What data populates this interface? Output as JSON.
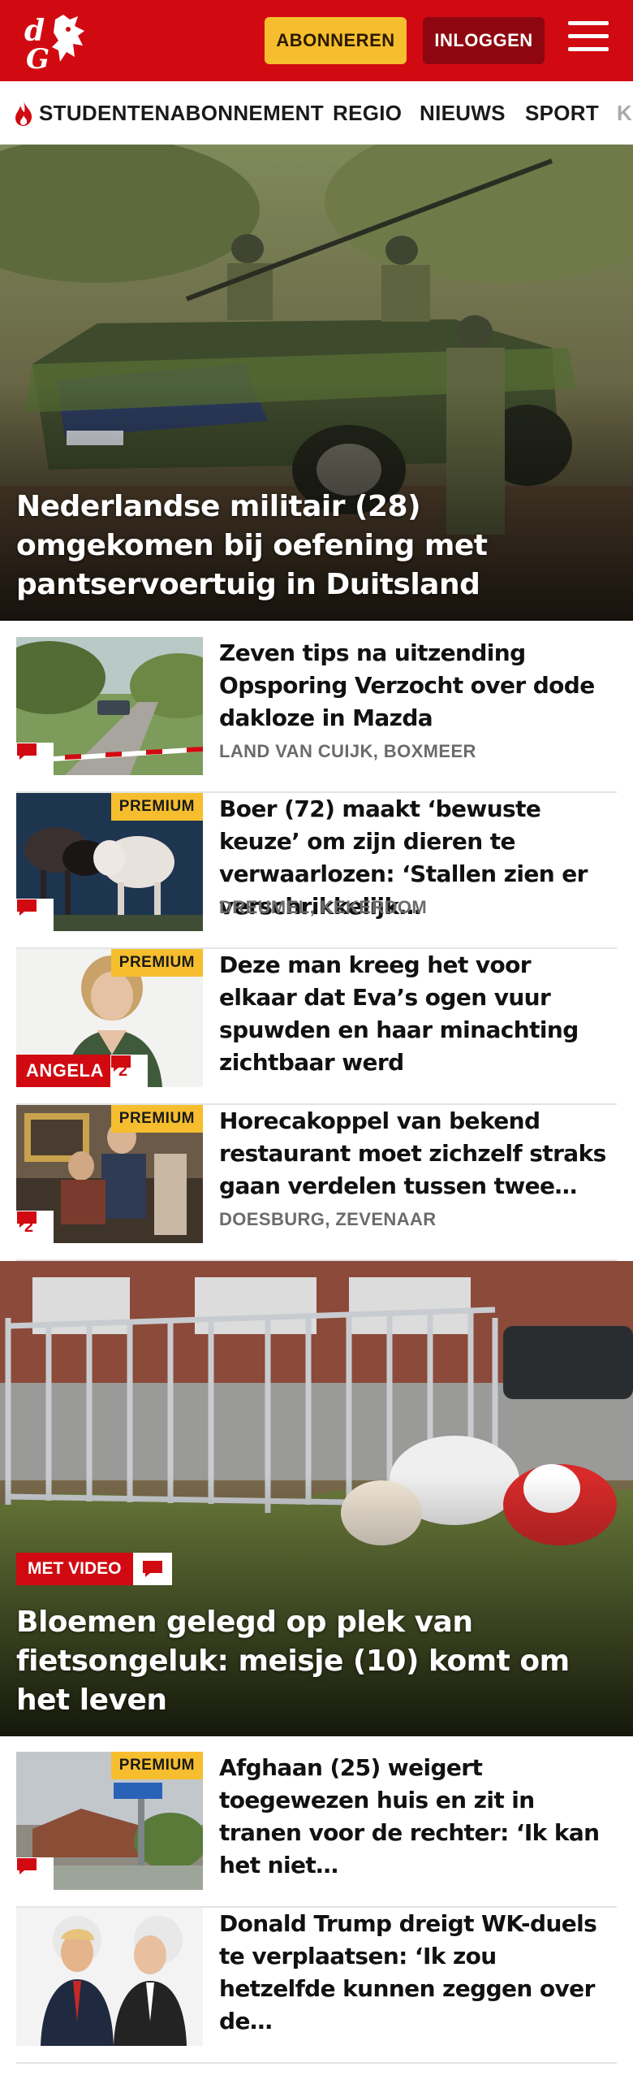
{
  "header": {
    "logo_text": "dG",
    "subscribe_label": "ABONNEREN",
    "login_label": "INLOGGEN",
    "brand_color": "#d10a11",
    "accent_color": "#f6be2e"
  },
  "nav": {
    "items": [
      {
        "label": "STUDENTENABONNEMENT",
        "icon": "flame-icon"
      },
      {
        "label": "REGIO"
      },
      {
        "label": "NIEUWS"
      },
      {
        "label": "SPORT"
      },
      {
        "label": "K"
      }
    ]
  },
  "hero1": {
    "title": "Nederlandse militair (28) omgekomen bij oefening met pantservoertuig in Duitsland"
  },
  "articles": [
    {
      "title": "Zeven tips na uitzending Opsporing Verzocht over dode dakloze in Mazda",
      "location": "LAND VAN CUIJK, BOXMEER",
      "comments": ""
    },
    {
      "title": "Boer (72) maakt ‘bewuste keuze’ om zijn dieren te verwaarlozen: ‘Stallen zien er verschrikkelijk…",
      "location": "DREUMEL, KEKERDOM",
      "premium": "PREMIUM",
      "comments": ""
    },
    {
      "title": "Deze man kreeg het voor elkaar dat Eva’s ogen vuur spuwden en haar minachting zichtbaar werd",
      "location": "",
      "premium": "PREMIUM",
      "tag": "ANGELA",
      "comments": "2"
    },
    {
      "title": "Horecakoppel van bekend restaurant moet zichzelf straks gaan verdelen tussen twee…",
      "location": "DOESBURG, ZEVENAAR",
      "premium": "PREMIUM",
      "comments": "2"
    }
  ],
  "hero2": {
    "badge": "MET VIDEO",
    "title": "Bloemen gelegd op plek van fietsongeluk: meisje (10) komt om het leven"
  },
  "articles2": [
    {
      "title": "Afghaan (25) weigert toegewezen huis en zit in tranen voor de rechter: ‘Ik kan het niet…",
      "premium": "PREMIUM",
      "comments": ""
    },
    {
      "title": "Donald Trump dreigt WK-duels te verplaatsen: ‘Ik zou hetzelfde kunnen zeggen over de…"
    }
  ]
}
